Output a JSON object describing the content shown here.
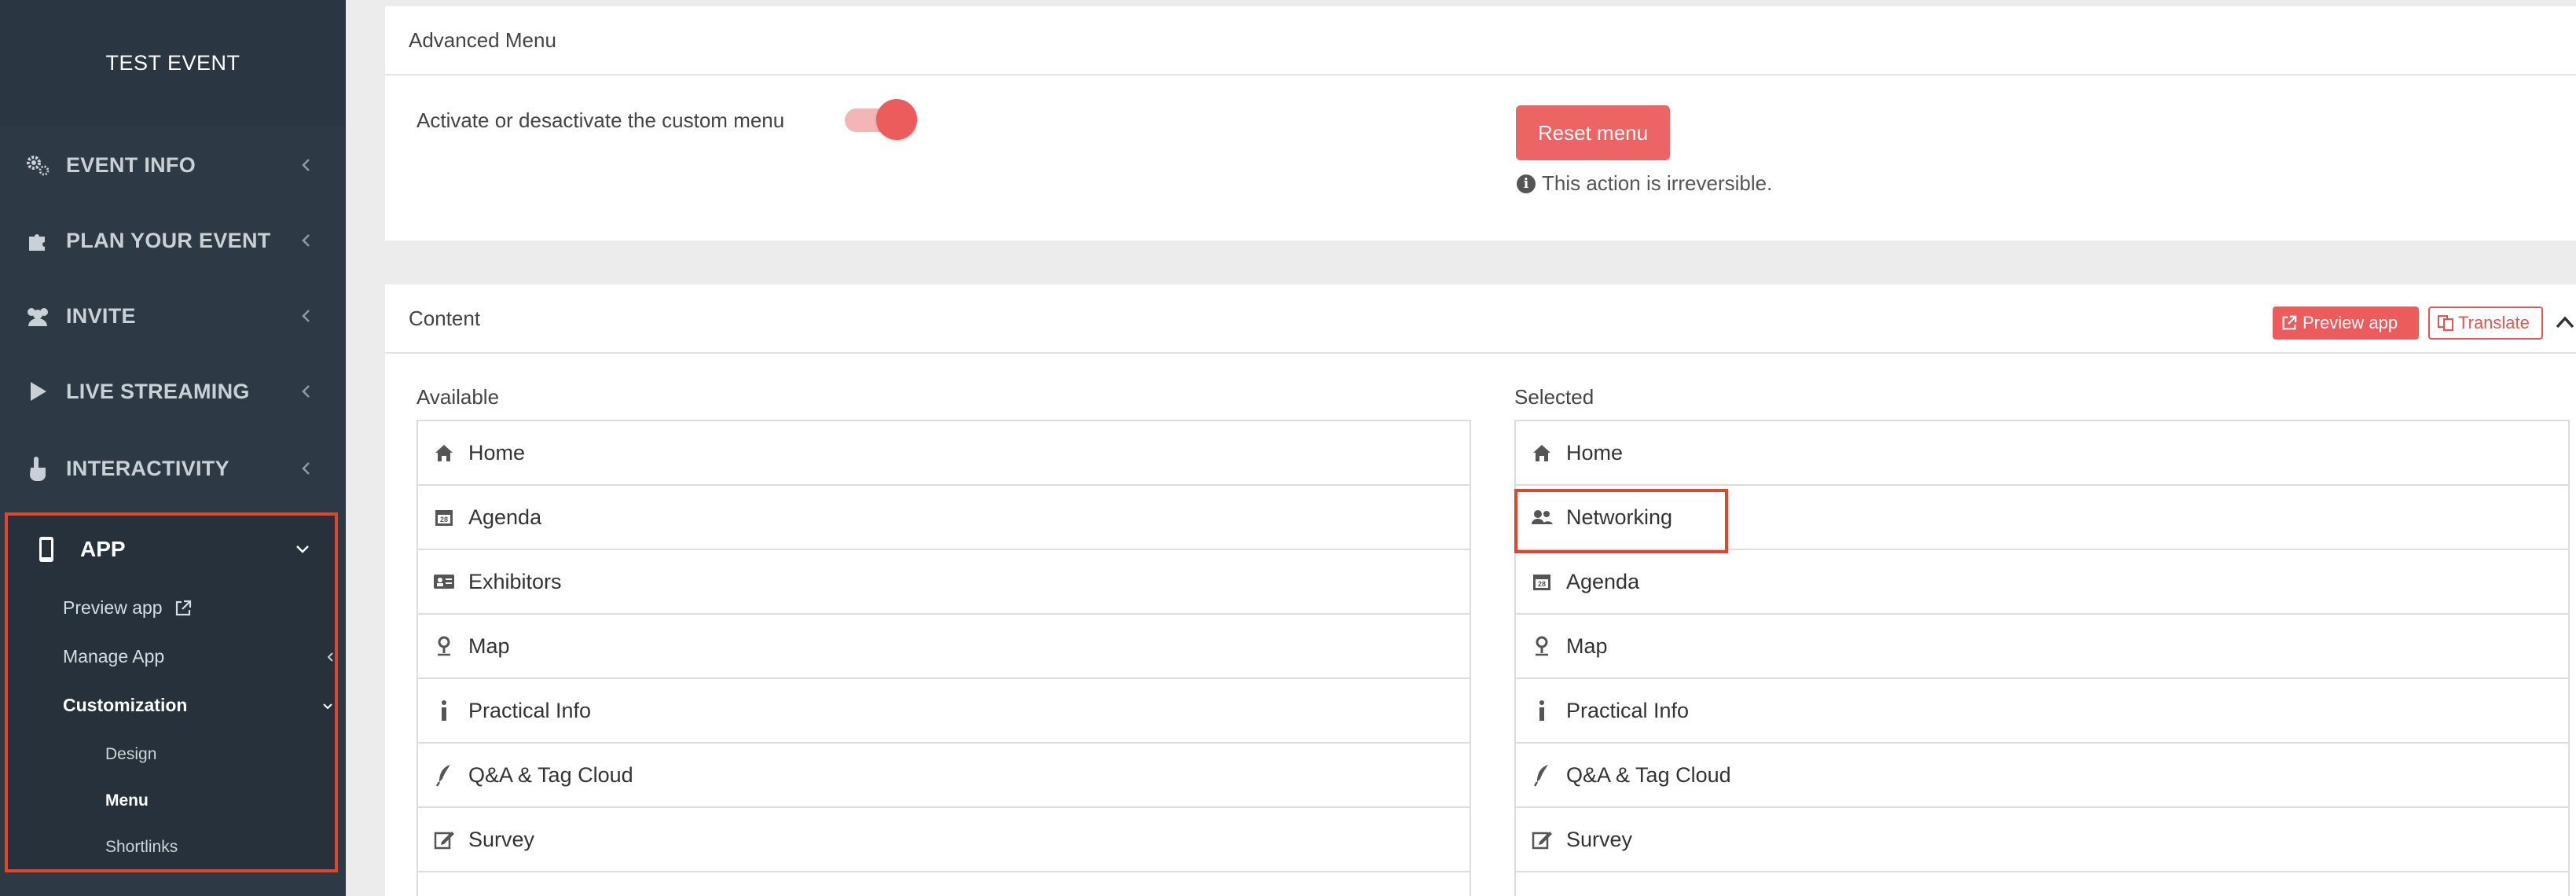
{
  "sidebar": {
    "brand": "TEST EVENT",
    "nav": [
      {
        "label": "EVENT INFO",
        "icon": "gears-icon"
      },
      {
        "label": "PLAN YOUR EVENT",
        "icon": "puzzle-icon"
      },
      {
        "label": "INVITE",
        "icon": "users-icon"
      },
      {
        "label": "LIVE STREAMING",
        "icon": "play-icon"
      },
      {
        "label": "INTERACTIVITY",
        "icon": "hand-pointer-icon"
      }
    ],
    "app": {
      "label": "APP",
      "icon": "mobile-icon",
      "items": [
        {
          "label": "Preview app",
          "icon": "external-link-icon"
        },
        {
          "label": "Manage App"
        },
        {
          "label": "Customization"
        }
      ],
      "customization_items": [
        "Design",
        "Menu",
        "Shortlinks"
      ],
      "active_subitem": "Menu"
    }
  },
  "advanced": {
    "title": "Advanced Menu",
    "toggle_label": "Activate or desactivate the custom menu",
    "toggle_on": true,
    "reset_label": "Reset menu",
    "warning": "This action is irreversible."
  },
  "content": {
    "title": "Content",
    "preview_label": "Preview app",
    "translate_label": "Translate",
    "available_title": "Available",
    "selected_title": "Selected",
    "available": [
      {
        "label": "Home",
        "icon": "home-icon"
      },
      {
        "label": "Agenda",
        "icon": "calendar-icon"
      },
      {
        "label": "Exhibitors",
        "icon": "id-card-icon"
      },
      {
        "label": "Map",
        "icon": "map-pin-icon"
      },
      {
        "label": "Practical Info",
        "icon": "info-icon"
      },
      {
        "label": "Q&A & Tag Cloud",
        "icon": "quill-icon"
      },
      {
        "label": "Survey",
        "icon": "edit-icon"
      }
    ],
    "selected": [
      {
        "label": "Home",
        "icon": "home-icon"
      },
      {
        "label": "Networking",
        "icon": "users-icon"
      },
      {
        "label": "Agenda",
        "icon": "calendar-icon"
      },
      {
        "label": "Map",
        "icon": "map-pin-icon"
      },
      {
        "label": "Practical Info",
        "icon": "info-icon"
      },
      {
        "label": "Q&A & Tag Cloud",
        "icon": "quill-icon"
      },
      {
        "label": "Survey",
        "icon": "edit-icon"
      }
    ]
  },
  "colors": {
    "sidebar_bg": "#2d3a46",
    "accent": "#ec5c5c",
    "highlight": "#e2452e"
  }
}
